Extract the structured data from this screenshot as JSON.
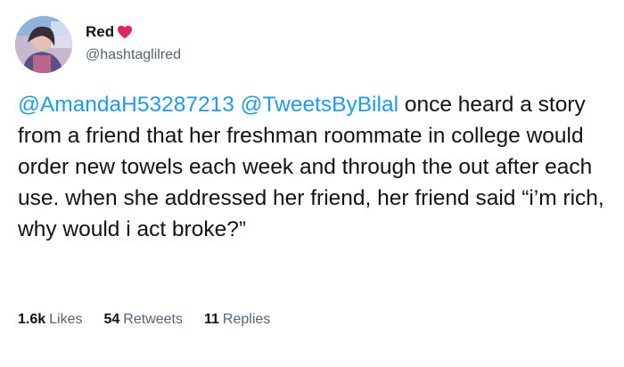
{
  "author": {
    "name": "Red",
    "handle": "@hashtaglilred",
    "avatar_icon": "profile-photo",
    "heart_icon": "red-heart-icon",
    "heart_color": "#e0245e"
  },
  "tweet": {
    "mention_1": "@AmandaH53287213",
    "mention_2": "@TweetsByBilal",
    "text": "once heard a story from a friend that her freshman roommate in college would order new towels each week and through the out after each use. when she addressed her friend, her friend said “i’m rich, why would i act broke?”",
    "mention_color": "#1d9bf0"
  },
  "stats": {
    "likes_count": "1.6k",
    "likes_label": "Likes",
    "retweets_count": "54",
    "retweets_label": "Retweets",
    "replies_count": "11",
    "replies_label": "Replies"
  }
}
